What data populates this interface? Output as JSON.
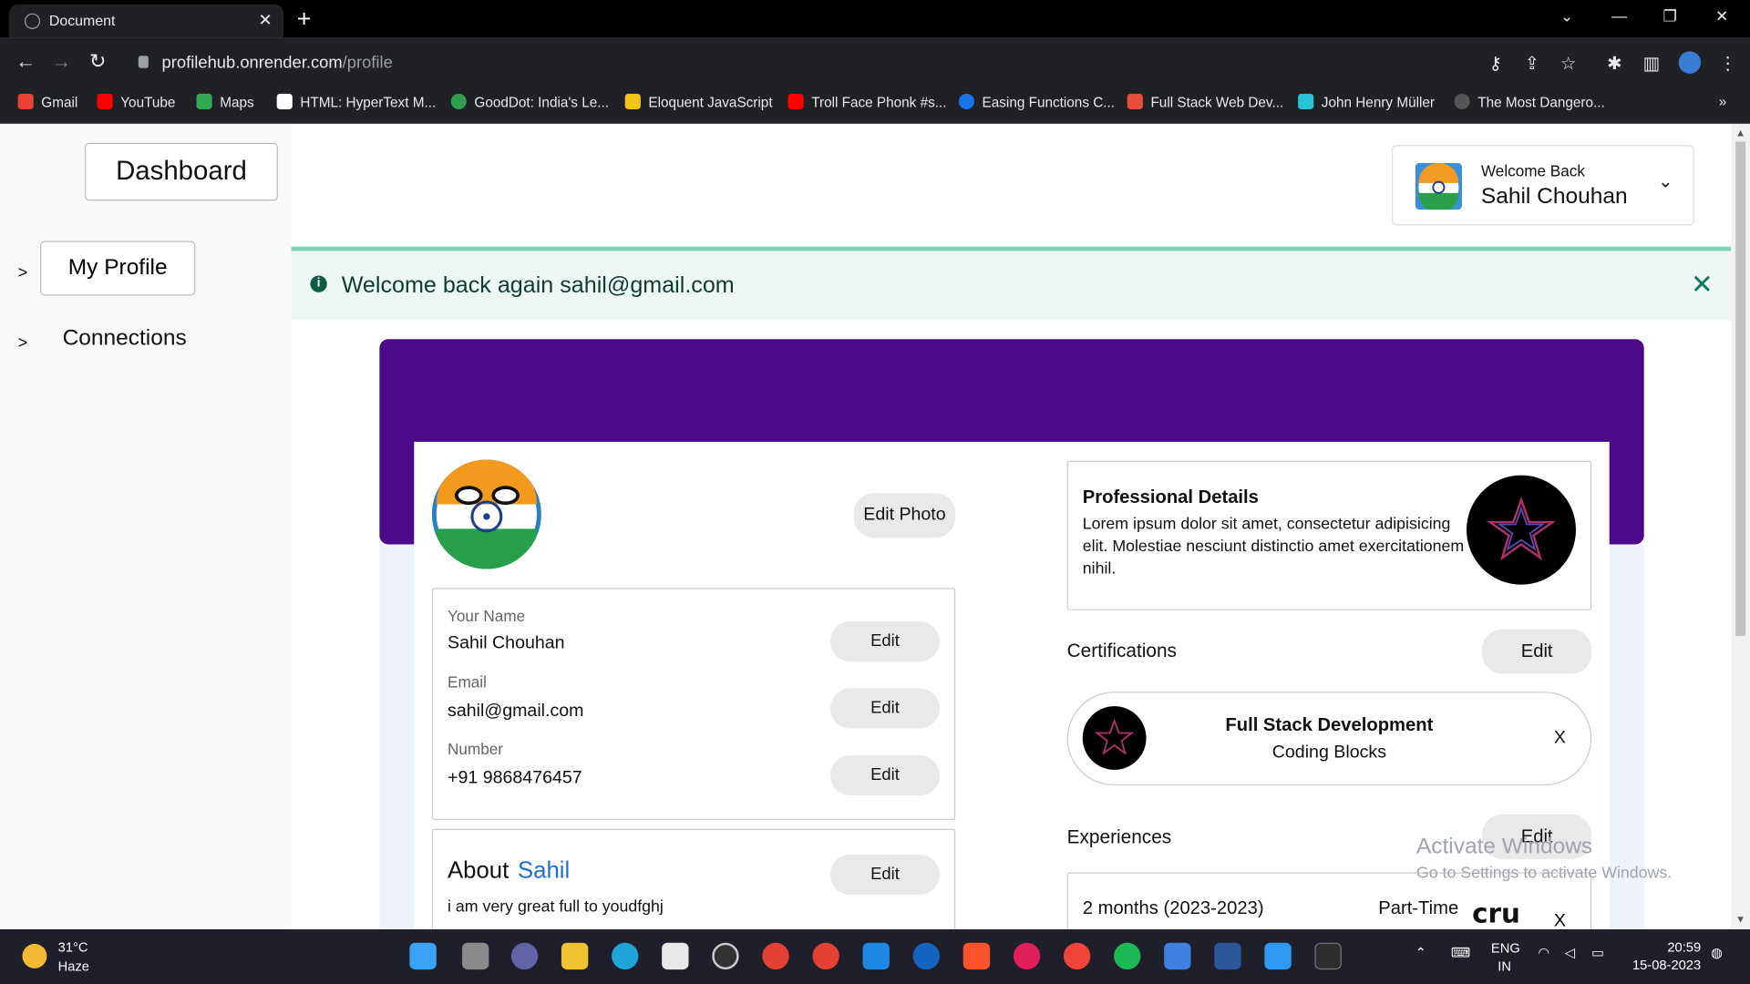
{
  "browser": {
    "tab_title": "Document",
    "url_host": "profilehub.onrender.com",
    "url_path": "/profile",
    "bookmarks": [
      "Gmail",
      "YouTube",
      "Maps",
      "HTML: HyperText M...",
      "GoodDot: India's Le...",
      "Eloquent JavaScript",
      "Troll Face Phonk #s...",
      "Easing Functions C...",
      "Full Stack Web Dev...",
      "John Henry Müller",
      "The Most Dangero..."
    ],
    "more_bookmarks": "»"
  },
  "sidebar": {
    "dashboard": "Dashboard",
    "items": [
      {
        "arrow": ">",
        "label": "My Profile"
      },
      {
        "arrow": ">",
        "label": "Connections"
      }
    ]
  },
  "header": {
    "welcome": "Welcome Back",
    "user_name": "Sahil Chouhan"
  },
  "alert": {
    "message": "Welcome back again sahil@gmail.com",
    "close": "✕"
  },
  "profile": {
    "edit_photo": "Edit Photo",
    "fields": [
      {
        "label": "Your Name",
        "value": "Sahil Chouhan",
        "action": "Edit"
      },
      {
        "label": "Email",
        "value": "sahil@gmail.com",
        "action": "Edit"
      },
      {
        "label": "Number",
        "value": "+91 9868476457",
        "action": "Edit"
      }
    ],
    "about_heading": "About",
    "about_name": "Sahil",
    "about_text": "i am very great full to youdfghj",
    "about_action": "Edit"
  },
  "professional": {
    "heading": "Professional Details",
    "text": "Lorem ipsum dolor sit amet, consectetur adipisicing elit. Molestiae nesciunt distinctio amet exercitationem nihil."
  },
  "certifications": {
    "heading": "Certifications",
    "action": "Edit",
    "items": [
      {
        "title": "Full Stack Development",
        "issuer": "Coding Blocks",
        "remove": "X"
      }
    ]
  },
  "experiences": {
    "heading": "Experiences",
    "action": "Edit",
    "items": [
      {
        "duration": "2 months (2023-2023)",
        "type": "Part-Time",
        "remove": "X",
        "logo_text": "cru"
      }
    ]
  },
  "watermark": {
    "line1": "Activate Windows",
    "line2": "Go to Settings to activate Windows."
  },
  "taskbar": {
    "temp": "31°C",
    "weather": "Haze",
    "lang1": "ENG",
    "lang2": "IN",
    "time": "20:59",
    "date": "15-08-2023"
  },
  "colors": {
    "banner": "#4c0a8b",
    "alert_bg": "#edf7f3",
    "alert_text": "#0f3d30",
    "accent_blue": "#1d6fd6"
  }
}
